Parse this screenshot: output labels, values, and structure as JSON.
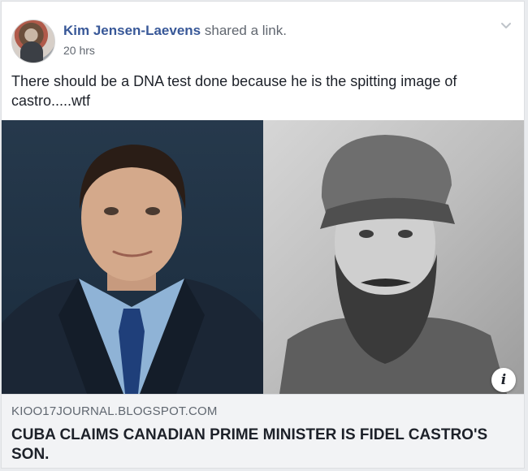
{
  "post": {
    "author": "Kim Jensen-Laevens",
    "action": "shared a link.",
    "timestamp": "20 hrs",
    "text": "There should be a DNA test done because he is the spitting image of castro.....wtf",
    "menu_icon": "chevron-down-icon"
  },
  "link_preview": {
    "domain": "KIOO17JOURNAL.BLOGSPOT.COM",
    "headline": "CUBA CLAIMS CANADIAN PRIME MINISTER IS FIDEL CASTRO'S SON.",
    "info_label": "i"
  },
  "colors": {
    "author": "#385898",
    "meta_bg": "#f2f3f5",
    "page_bg": "#e9ebee"
  }
}
